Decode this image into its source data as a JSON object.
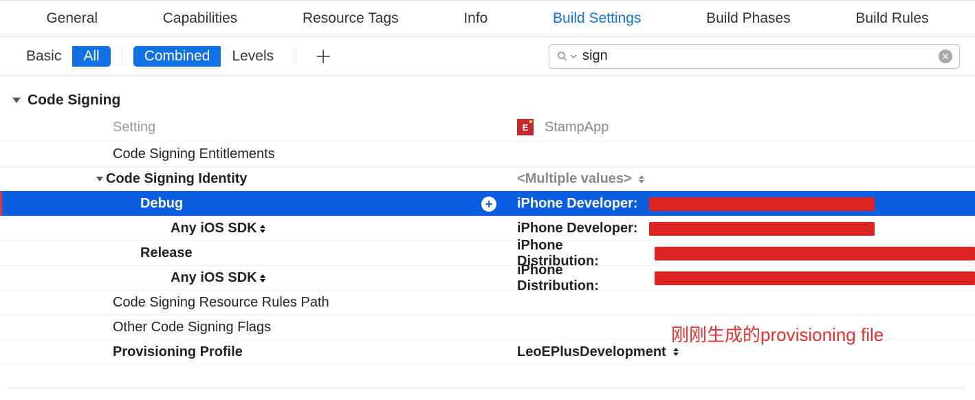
{
  "tabs": {
    "general": "General",
    "capabilities": "Capabilities",
    "resource_tags": "Resource Tags",
    "info": "Info",
    "build_settings": "Build Settings",
    "build_phases": "Build Phases",
    "build_rules": "Build Rules"
  },
  "toolbar": {
    "basic": "Basic",
    "all": "All",
    "combined": "Combined",
    "levels": "Levels"
  },
  "search": {
    "value": "sign"
  },
  "section": {
    "title": "Code Signing",
    "header_left": "Setting",
    "target_name": "StampApp",
    "target_glyph": "E"
  },
  "rows": {
    "entitlements": "Code Signing Entitlements",
    "identity": "Code Signing Identity",
    "identity_value": "<Multiple values>",
    "debug": "Debug",
    "debug_value": "iPhone Developer:",
    "any_sdk": "Any iOS SDK",
    "debug_any_value": "iPhone Developer:",
    "release": "Release",
    "release_value": "iPhone Distribution:",
    "release_any_value": "iPhone Distribution:",
    "rules_path": "Code Signing Resource Rules Path",
    "other_flags": "Other Code Signing Flags",
    "provisioning": "Provisioning Profile",
    "provisioning_value": "LeoEPlusDevelopment"
  },
  "annotation": "刚刚生成的provisioning file"
}
